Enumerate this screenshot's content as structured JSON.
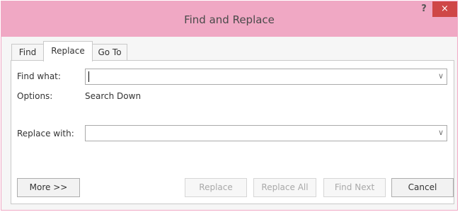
{
  "window": {
    "title": "Find and Replace",
    "help_label": "?",
    "close_label": "×"
  },
  "tabs": [
    {
      "label": "Find",
      "active": false
    },
    {
      "label": "Replace",
      "active": true
    },
    {
      "label": "Go To",
      "active": false
    }
  ],
  "find": {
    "label": "Find what:",
    "value": ""
  },
  "options": {
    "label": "Options:",
    "value": "Search Down"
  },
  "replace": {
    "label": "Replace with:",
    "value": ""
  },
  "dropdown_icon": "chevron-down-icon",
  "buttons": {
    "more": "More >>",
    "replace": "Replace",
    "replace_all": "Replace All",
    "find_next": "Find Next",
    "cancel": "Cancel"
  }
}
